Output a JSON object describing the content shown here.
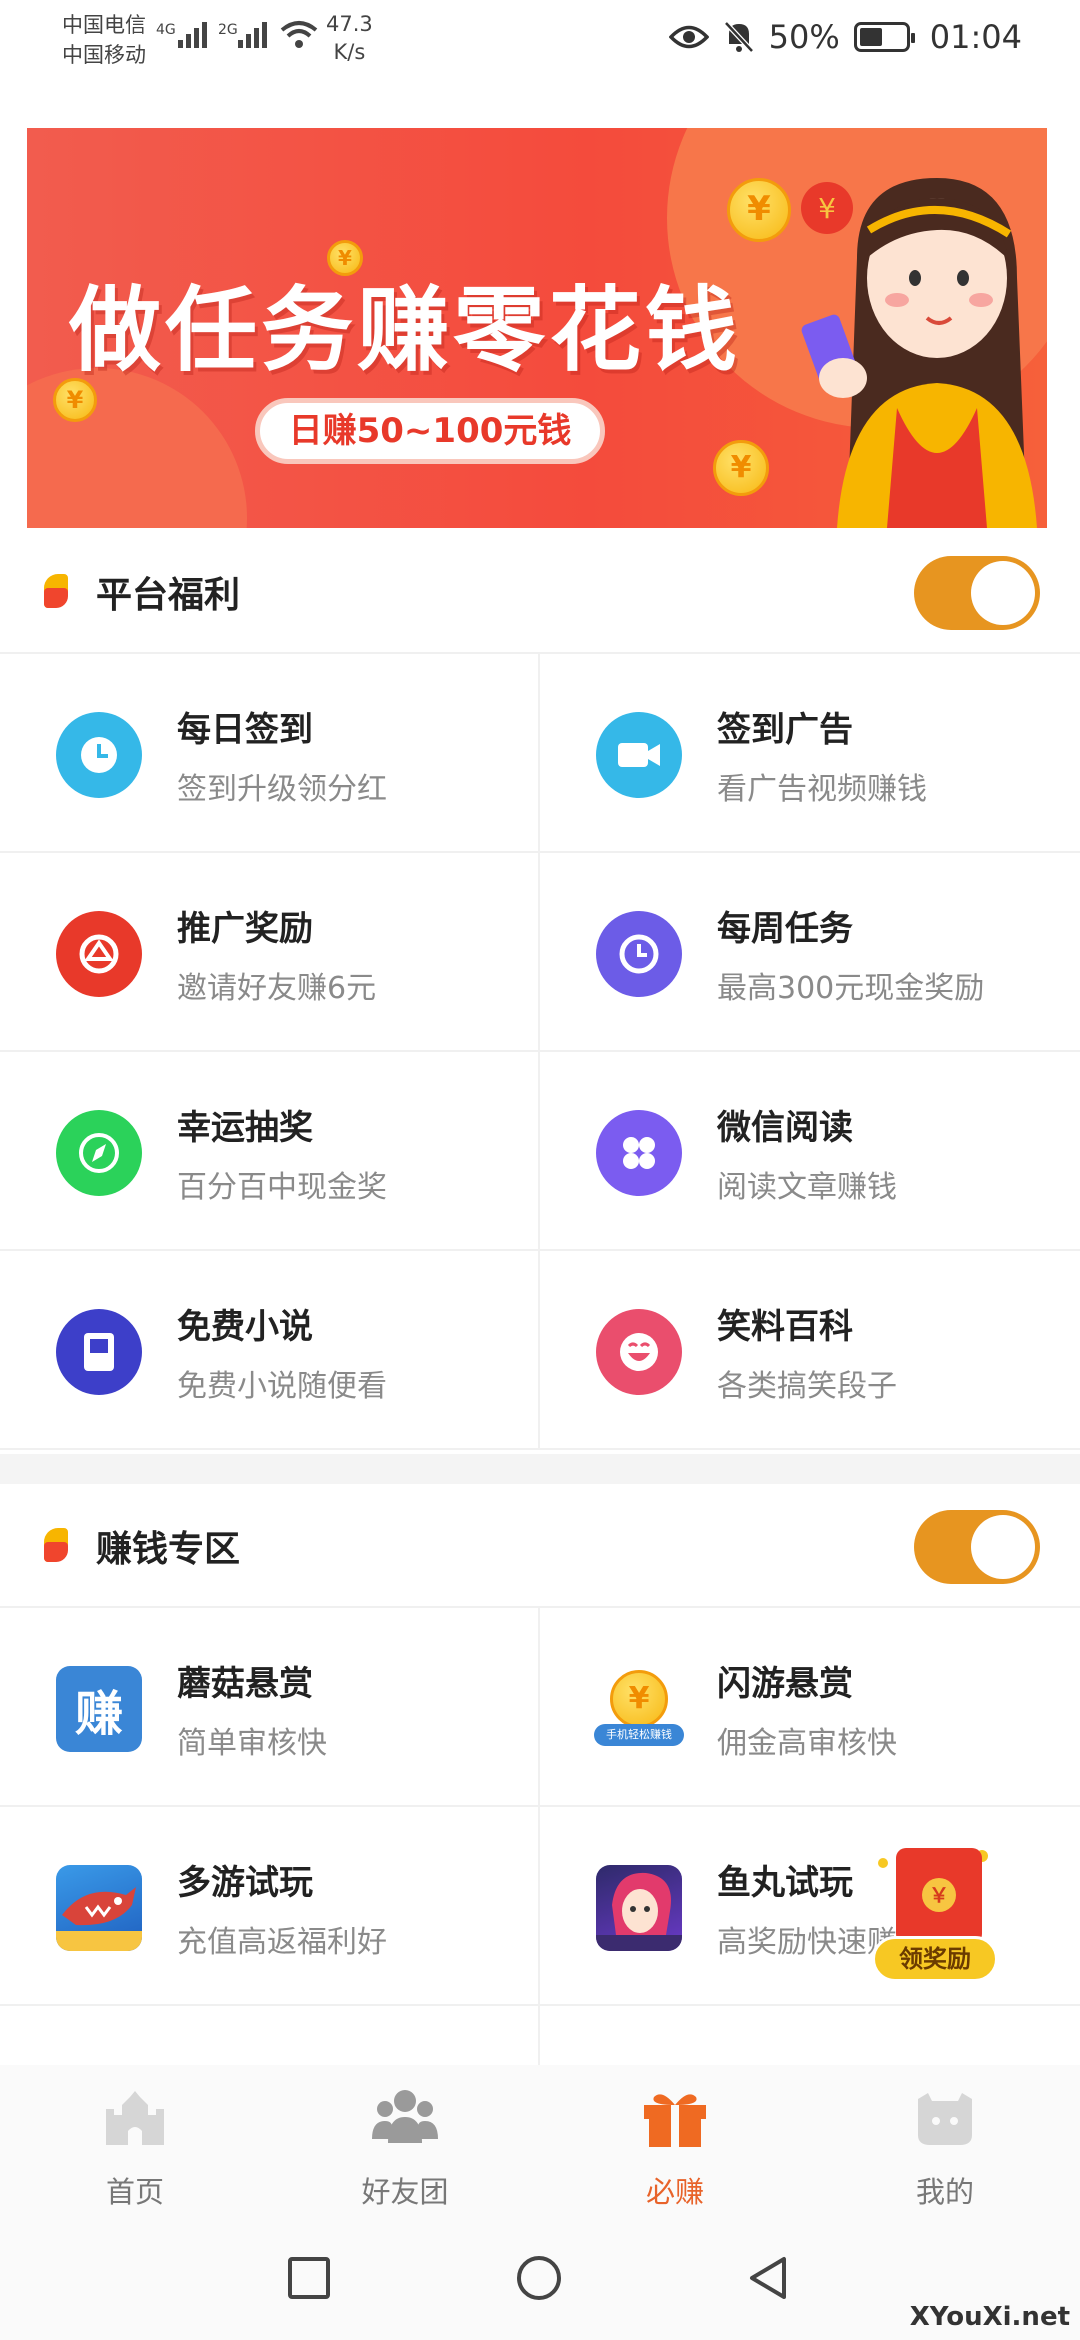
{
  "status_bar": {
    "carrier_1": "中国电信",
    "carrier_2": "中国移动",
    "signal_1": "4G",
    "signal_2": "2G",
    "net_speed_value": "47.3",
    "net_speed_unit": "K/s",
    "battery": "50%",
    "time": "01:04"
  },
  "banner": {
    "title": "做任务赚零花钱",
    "subtitle": "日赚50~100元钱",
    "coin_symbol": "¥"
  },
  "section_welfare": {
    "title": "平台福利",
    "items": [
      {
        "title": "每日签到",
        "desc": "签到升级领分红",
        "icon": "clock-icon",
        "color": "#35b8e8"
      },
      {
        "title": "签到广告",
        "desc": "看广告视频赚钱",
        "icon": "video-camera-icon",
        "color": "#35b8e8"
      },
      {
        "title": "推广奖励",
        "desc": "邀请好友赚6元",
        "icon": "share-icon",
        "color": "#e8392a"
      },
      {
        "title": "每周任务",
        "desc": "最高300元现金奖励",
        "icon": "clock-icon",
        "color": "#6c5ce7"
      },
      {
        "title": "幸运抽奖",
        "desc": "百分百中现金奖",
        "icon": "compass-icon",
        "color": "#2bd25a"
      },
      {
        "title": "微信阅读",
        "desc": "阅读文章赚钱",
        "icon": "clover-icon",
        "color": "#7b5cf0"
      },
      {
        "title": "免费小说",
        "desc": "免费小说随便看",
        "icon": "book-icon",
        "color": "#3d3fc9"
      },
      {
        "title": "笑料百科",
        "desc": "各类搞笑段子",
        "icon": "laugh-icon",
        "color": "#ea4e6d"
      }
    ]
  },
  "section_earn": {
    "title": "赚钱专区",
    "items": [
      {
        "title": "蘑菇悬赏",
        "desc": "简单审核快",
        "icon": "zhuan-icon",
        "icon_text": "赚",
        "color": "#3a86d6"
      },
      {
        "title": "闪游悬赏",
        "desc": "佣金高审核快",
        "icon": "coin-phone-icon",
        "icon_text": "手机轻松赚钱",
        "color": "#f7b813"
      },
      {
        "title": "多游试玩",
        "desc": "充值高返福利好",
        "icon": "shark-game-icon",
        "color": "#1f5fbf"
      },
      {
        "title": "鱼丸试玩",
        "desc": "高奖励快速赚",
        "icon": "avatar-game-icon",
        "color": "#6b3ac9"
      }
    ]
  },
  "float_reward": {
    "label": "领奖励"
  },
  "bottom_nav": [
    {
      "label": "首页",
      "icon": "castle-icon",
      "active": false
    },
    {
      "label": "好友团",
      "icon": "friends-icon",
      "active": false
    },
    {
      "label": "必赚",
      "icon": "gift-icon",
      "active": true
    },
    {
      "label": "我的",
      "icon": "profile-icon",
      "active": false
    }
  ],
  "colors": {
    "accent": "#e79520",
    "banner_red": "#f44b3c",
    "active_tab": "#e8632a"
  },
  "watermark": "XYouXi.net"
}
